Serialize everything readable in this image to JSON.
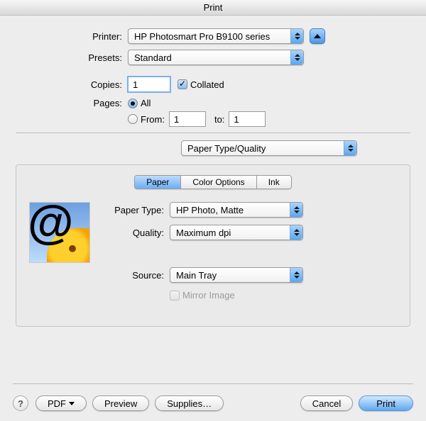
{
  "window": {
    "title": "Print"
  },
  "labels": {
    "printer": "Printer:",
    "presets": "Presets:",
    "copies": "Copies:",
    "collated": "Collated",
    "pages": "Pages:",
    "all": "All",
    "from": "From:",
    "to": "to:"
  },
  "printer": {
    "selected": "HP Photosmart Pro B9100 series"
  },
  "presets": {
    "selected": "Standard"
  },
  "copies": {
    "value": "1",
    "collated": true
  },
  "pages": {
    "mode": "all",
    "from": "1",
    "to": "1"
  },
  "section_popup": {
    "selected": "Paper Type/Quality"
  },
  "tabs": {
    "items": [
      "Paper",
      "Color Options",
      "Ink"
    ],
    "selected": 0
  },
  "paper_panel": {
    "labels": {
      "paper_type": "Paper Type:",
      "quality": "Quality:",
      "source": "Source:",
      "mirror": "Mirror Image"
    },
    "paper_type": "HP Photo, Matte",
    "quality": "Maximum dpi",
    "source": "Main Tray",
    "mirror": false,
    "mirror_enabled": false
  },
  "buttons": {
    "help": "?",
    "pdf": "PDF",
    "preview": "Preview",
    "supplies": "Supplies…",
    "cancel": "Cancel",
    "print": "Print"
  }
}
